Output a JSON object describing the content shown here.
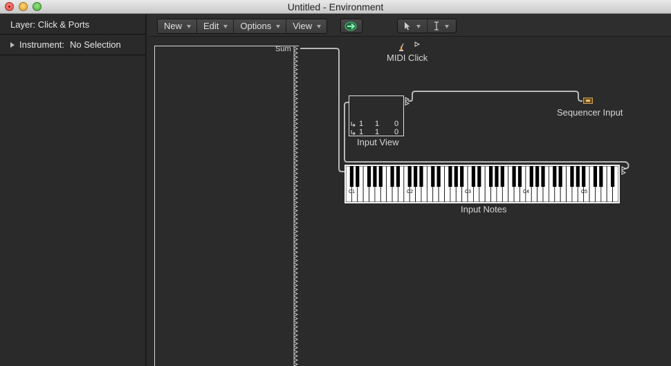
{
  "window": {
    "title": "Untitled - Environment"
  },
  "left_panel": {
    "layer_label": "Layer: Click & Ports",
    "instrument_label": "Instrument:",
    "instrument_value": "No Selection"
  },
  "toolbar": {
    "menus": [
      {
        "label": "New"
      },
      {
        "label": "Edit"
      },
      {
        "label": "Options"
      },
      {
        "label": "View"
      }
    ],
    "link_icon": "link-arrow-icon",
    "tools": [
      {
        "icon": "pointer-tool-icon"
      },
      {
        "icon": "text-tool-icon"
      }
    ],
    "accent_color": "#3fae6a"
  },
  "canvas": {
    "sum_label": "Sum",
    "midi_click_label": "MIDI Click",
    "input_view": {
      "label": "Input View",
      "rows": [
        {
          "a": "1",
          "b": "1",
          "c": "0"
        },
        {
          "a": "1",
          "b": "1",
          "c": "0"
        }
      ]
    },
    "sequencer_input_label": "Sequencer Input",
    "keyboard": {
      "label": "Input Notes",
      "octave_labels": [
        "C1",
        "C2",
        "C3",
        "C4",
        "C5"
      ]
    }
  }
}
